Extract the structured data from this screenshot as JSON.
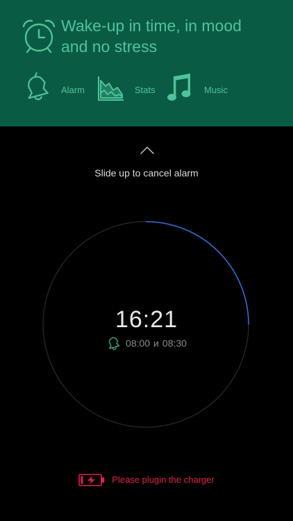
{
  "header": {
    "tagline_line1": "Wake-up in time, in mood",
    "tagline_line2": "and no stress",
    "clock_icon": "alarm-clock-icon",
    "accent_color": "#4fc39b",
    "background_color": "#0a5b43"
  },
  "nav": {
    "items": [
      {
        "label": "Alarm",
        "icon": "bell-icon"
      },
      {
        "label": "Stats",
        "icon": "chart-icon"
      },
      {
        "label": "Music",
        "icon": "music-note-icon"
      }
    ]
  },
  "slide": {
    "icon": "chevron-up-icon",
    "label": "Slide up to cancel alarm"
  },
  "clock": {
    "time": "16:21",
    "alarm_icon": "bell-icon",
    "alarm_start": "08:00",
    "alarm_joiner": "и",
    "alarm_end": "08:30",
    "ring_color": "#2f6fd6",
    "progress_fraction": 0.25
  },
  "charger": {
    "icon": "battery-charging-icon",
    "text": "Please plugin the charger",
    "color": "#e1214b"
  }
}
